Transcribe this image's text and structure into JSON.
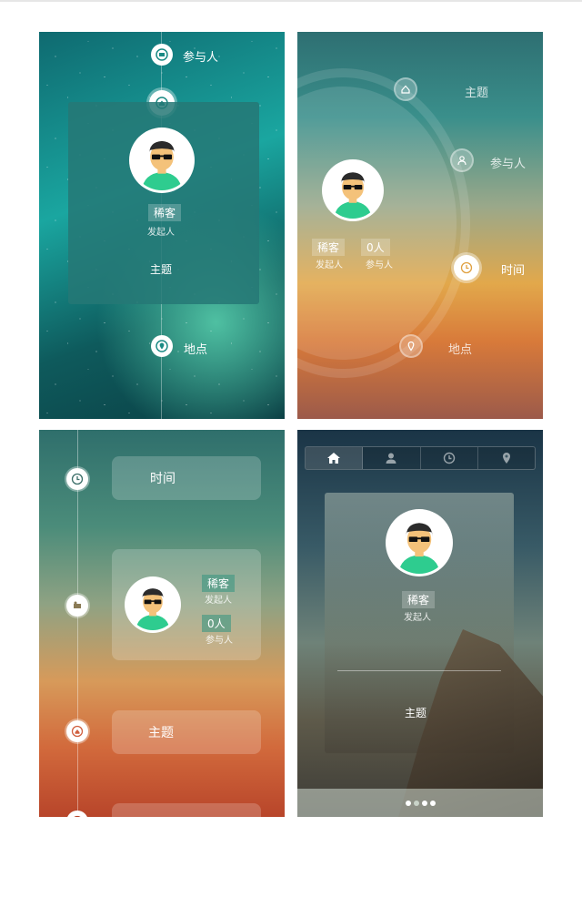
{
  "panel1": {
    "participants_label": "参与人",
    "name": "稀客",
    "role": "发起人",
    "topic": "主题",
    "location_label": "地点"
  },
  "panel2": {
    "topic_label": "主题",
    "participants_label": "参与人",
    "time_label": "时间",
    "location_label": "地点",
    "name": "稀客",
    "role": "发起人",
    "count": "0人",
    "count_label": "参与人"
  },
  "panel3": {
    "time_label": "时间",
    "name": "稀客",
    "role": "发起人",
    "count": "0人",
    "count_label": "参与人",
    "topic_label": "主题"
  },
  "panel4": {
    "tabs": [
      {
        "icon": "home-icon"
      },
      {
        "icon": "user-icon"
      },
      {
        "icon": "clock-icon"
      },
      {
        "icon": "location-pin-icon"
      }
    ],
    "name": "稀客",
    "role": "发起人",
    "topic": "主题",
    "pager_total": 4,
    "pager_active": 2
  },
  "colors": {
    "avatar_shirt": "#2ecc8f",
    "avatar_skin": "#f4c27a",
    "avatar_hair": "#2b2b2b"
  }
}
